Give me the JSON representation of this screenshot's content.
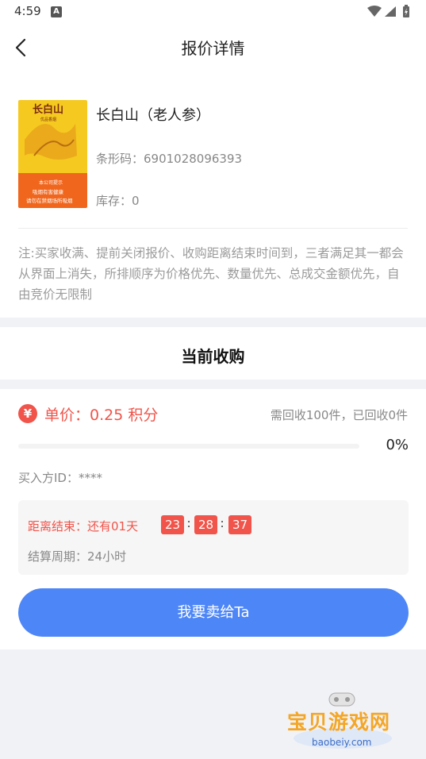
{
  "status_bar": {
    "time": "4:59",
    "notification_letter": "A"
  },
  "header": {
    "title": "报价详情",
    "back_icon": "back-arrow-icon"
  },
  "product": {
    "name": "长白山（老人参）",
    "barcode": "条形码：6901028096393",
    "stock": "库存：0",
    "image_caption_lines": [
      "本公司提示",
      "吸烟有害健康",
      "请勿在禁烟场所吸烟"
    ]
  },
  "notice": "注:买家收满、提前关闭报价、收购距离结束时间到，三者满足其一都会从界面上消失，所排顺序为价格优先、数量优先、总成交金额优先，自由竞价无限制",
  "section_title": "当前收购",
  "purchase": {
    "currency_symbol": "¥",
    "unit_price": "单价：0.25 积分",
    "recycle_status": "需回收100件，已回收0件",
    "progress_fraction": 0,
    "progress_label": "0%",
    "buyer_id": "买入方ID：****",
    "countdown_label": "距离结束：还有01天",
    "countdown": {
      "hours": "23",
      "minutes": "28",
      "seconds": "37"
    },
    "separator": ":",
    "settlement": "结算周期：24小时"
  },
  "sell_button": "我要卖给Ta",
  "watermark": {
    "text": "宝贝游戏网",
    "url": "baobeiy.com"
  },
  "colors": {
    "accent_red": "#f0544a",
    "primary_blue": "#4d86f7",
    "page_bg": "#f1f2f6"
  }
}
